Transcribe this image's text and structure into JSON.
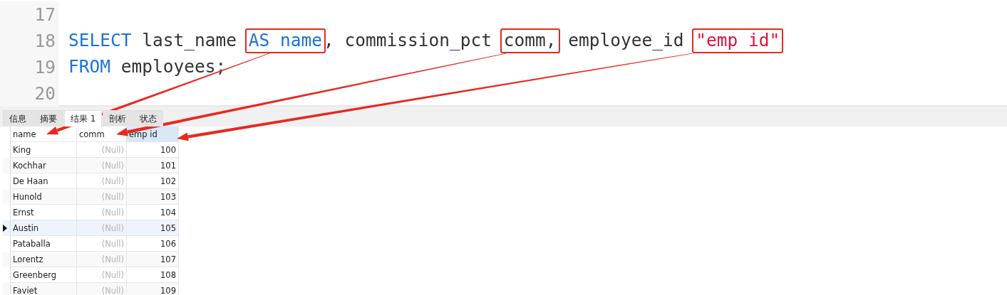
{
  "editor": {
    "lines": [
      {
        "number": "17"
      },
      {
        "number": "18",
        "tokens": [
          {
            "text": "SELECT",
            "kind": "keyword",
            "boxed": false
          },
          {
            "text": " last_name ",
            "kind": "plain",
            "boxed": false
          },
          {
            "text": "AS name",
            "kind": "keyword",
            "boxed": true
          },
          {
            "text": ", commission_pct ",
            "kind": "plain",
            "boxed": false
          },
          {
            "text": "comm,",
            "kind": "plain",
            "boxed": true
          },
          {
            "text": " employee_id ",
            "kind": "plain",
            "boxed": false
          },
          {
            "text": "\"emp id\"",
            "kind": "string",
            "boxed": true
          }
        ]
      },
      {
        "number": "19",
        "tokens": [
          {
            "text": "FROM",
            "kind": "keyword",
            "boxed": false
          },
          {
            "text": " employees;",
            "kind": "plain",
            "boxed": false
          }
        ]
      },
      {
        "number": "20"
      }
    ]
  },
  "tabs": [
    {
      "label": "信息",
      "selected": false
    },
    {
      "label": "摘要",
      "selected": false
    },
    {
      "label": "结果 1",
      "selected": true
    },
    {
      "label": "剖析",
      "selected": false
    },
    {
      "label": "状态",
      "selected": false
    }
  ],
  "grid": {
    "columns": [
      {
        "label": "name",
        "kind": "text",
        "selected": false
      },
      {
        "label": "comm",
        "kind": "null",
        "selected": false
      },
      {
        "label": "emp id",
        "kind": "number",
        "selected": true
      }
    ],
    "rows": [
      {
        "cells": [
          "King",
          "(Null)",
          "100"
        ],
        "current": false
      },
      {
        "cells": [
          "Kochhar",
          "(Null)",
          "101"
        ],
        "current": false
      },
      {
        "cells": [
          "De Haan",
          "(Null)",
          "102"
        ],
        "current": false
      },
      {
        "cells": [
          "Hunold",
          "(Null)",
          "103"
        ],
        "current": false
      },
      {
        "cells": [
          "Ernst",
          "(Null)",
          "104"
        ],
        "current": false
      },
      {
        "cells": [
          "Austin",
          "(Null)",
          "105"
        ],
        "current": true
      },
      {
        "cells": [
          "Pataballa",
          "(Null)",
          "106"
        ],
        "current": false
      },
      {
        "cells": [
          "Lorentz",
          "(Null)",
          "107"
        ],
        "current": false
      },
      {
        "cells": [
          "Greenberg",
          "(Null)",
          "108"
        ],
        "current": false
      },
      {
        "cells": [
          "Faviet",
          "(Null)",
          "109"
        ],
        "current": false
      }
    ]
  }
}
